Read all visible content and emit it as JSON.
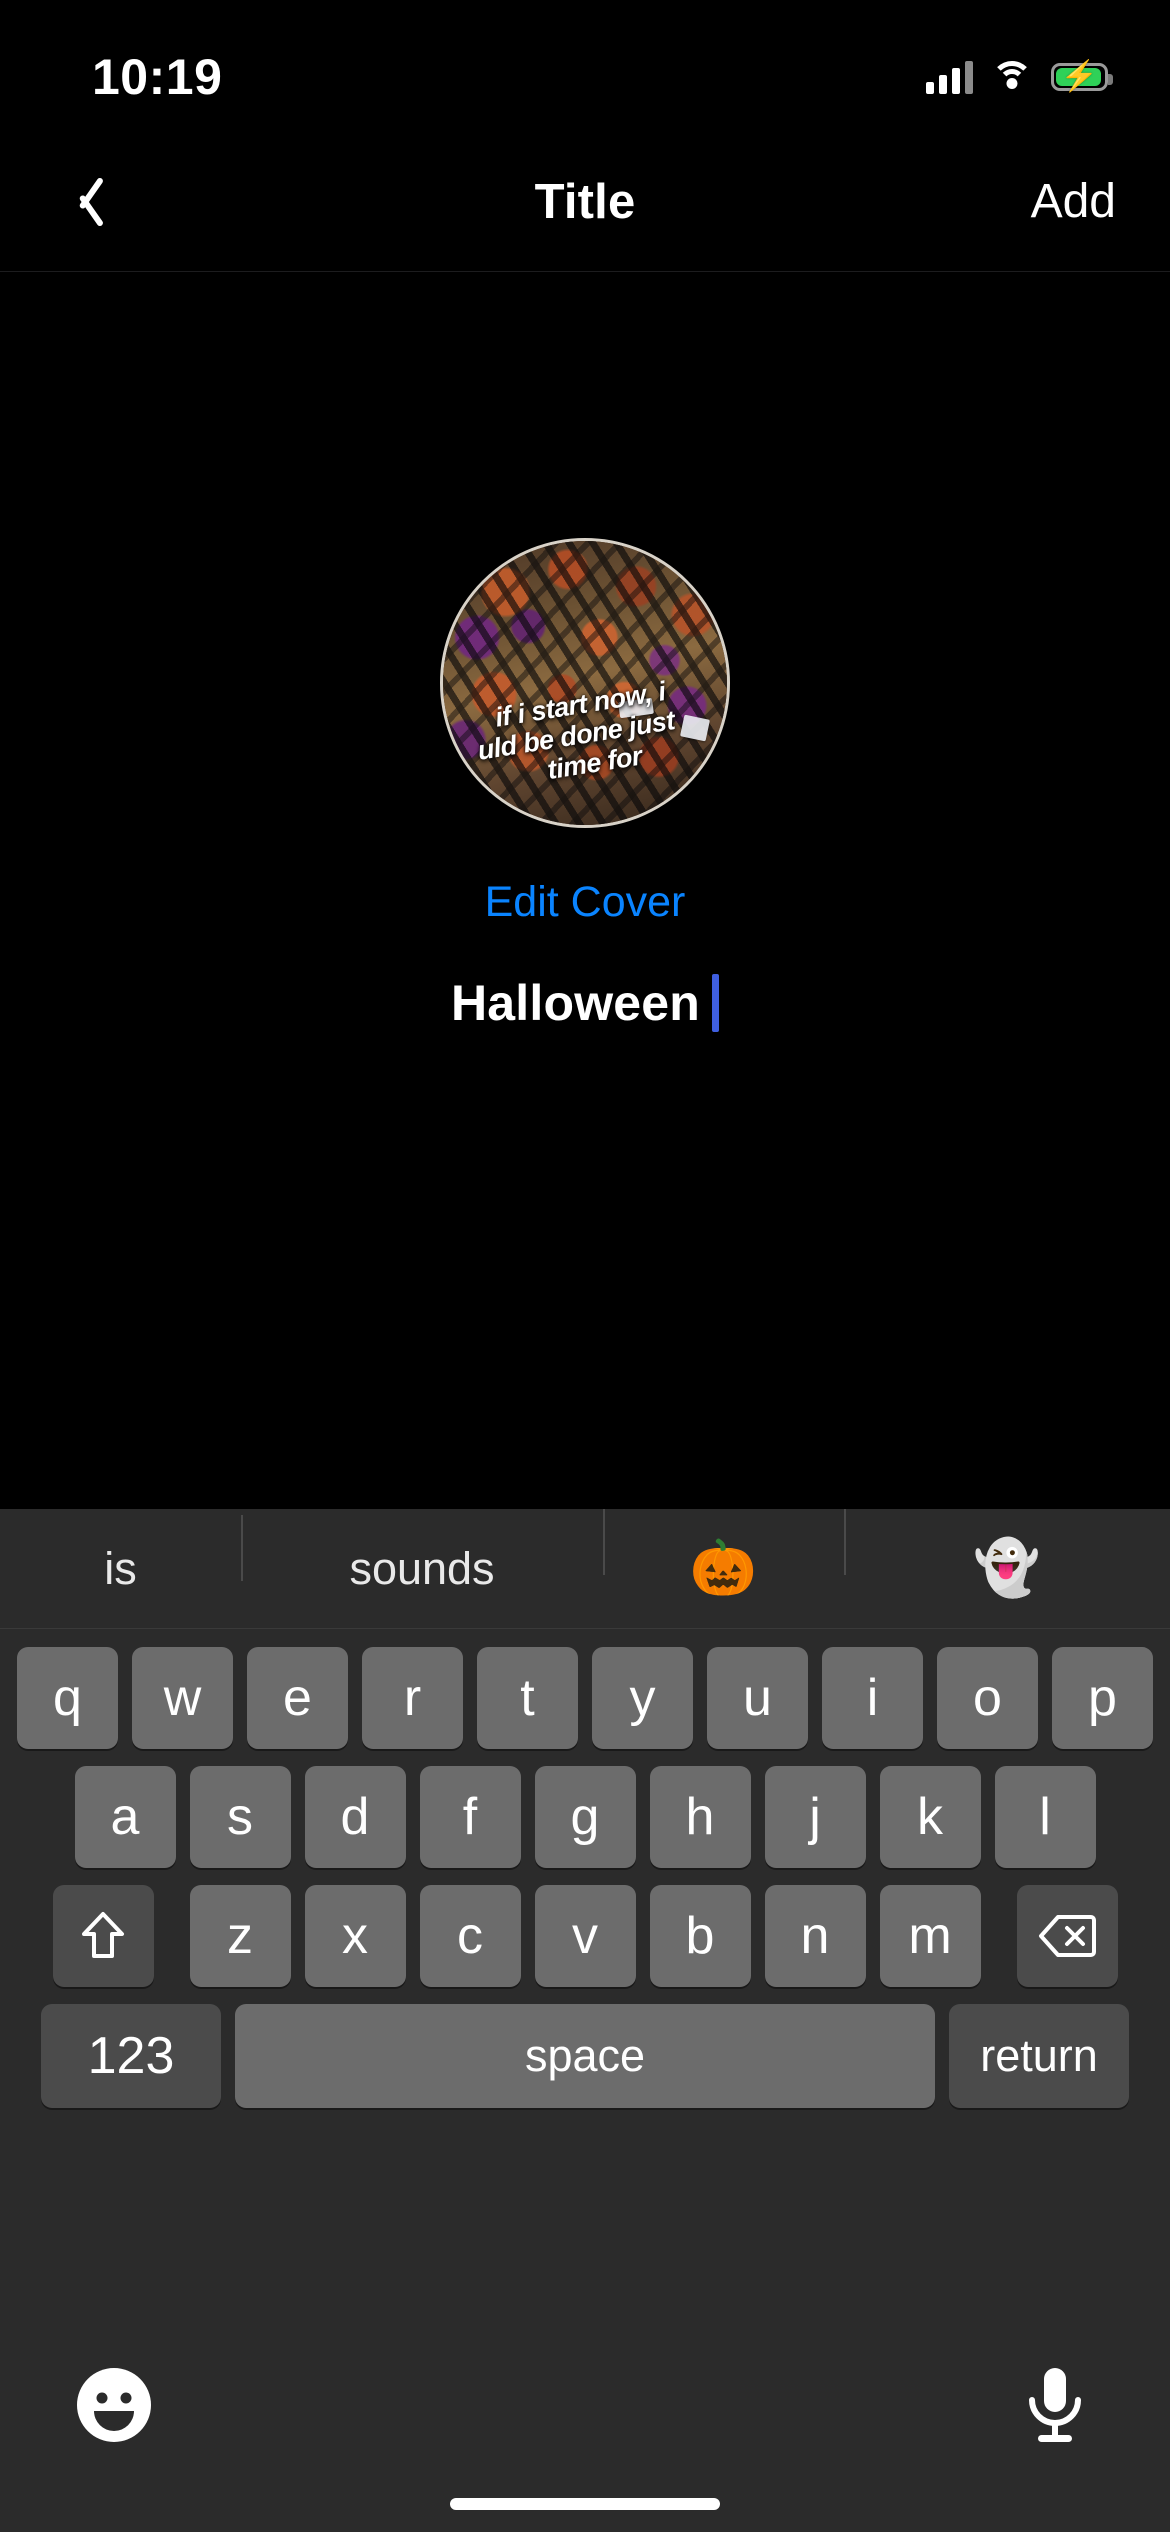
{
  "status_bar": {
    "time": "10:19",
    "signal_icon": "cellular-signal-icon",
    "wifi_icon": "wifi-icon",
    "battery_icon": "battery-charging-icon",
    "battery_color": "#2fd158"
  },
  "nav_bar": {
    "back_icon": "chevron-left-icon",
    "title": "Title",
    "add_label": "Add"
  },
  "cover": {
    "image_alt": "halloween-string-lights-photo",
    "image_overlay_lines": [
      "if i start now, i",
      "uld be done just",
      "time for"
    ],
    "edit_label": "Edit Cover",
    "edit_color": "#0a84ff"
  },
  "title_field": {
    "value": "Halloween",
    "caret_color": "#3f5fe0"
  },
  "keyboard": {
    "predictive": [
      {
        "label": "is",
        "type": "word"
      },
      {
        "label": "sounds",
        "type": "word"
      },
      {
        "label": "🎃",
        "type": "emoji"
      },
      {
        "label": "👻",
        "type": "emoji"
      }
    ],
    "row1": [
      "q",
      "w",
      "e",
      "r",
      "t",
      "y",
      "u",
      "i",
      "o",
      "p"
    ],
    "row2": [
      "a",
      "s",
      "d",
      "f",
      "g",
      "h",
      "j",
      "k",
      "l"
    ],
    "row3": [
      "z",
      "x",
      "c",
      "v",
      "b",
      "n",
      "m"
    ],
    "shift_icon": "shift-arrow-icon",
    "backspace_icon": "backspace-icon",
    "numbers_label": "123",
    "space_label": "space",
    "return_label": "return",
    "emoji_icon": "smiley-face-icon",
    "mic_icon": "microphone-icon",
    "key_color": "#6c6c6c",
    "modifier_key_color": "#4b4b4b",
    "background_color": "#2b2b2b"
  }
}
